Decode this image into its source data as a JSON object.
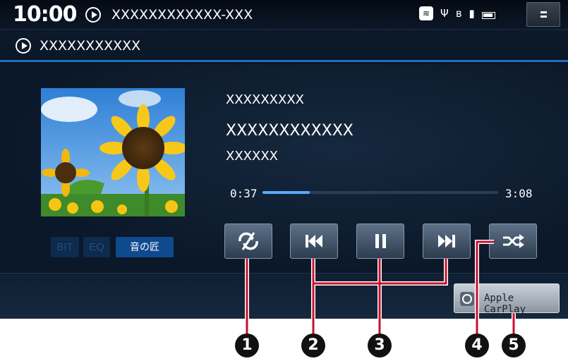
{
  "status_bar": {
    "clock": "10:00",
    "now_playing": "XXXXXXXXXXXX-XXX",
    "icons": [
      "wifi-icon",
      "usb-icon",
      "bluetooth-icon",
      "signal-icon",
      "battery-icon"
    ],
    "menu_icon": "menu-icon"
  },
  "source_bar": {
    "title": "XXXXXXXXXXX"
  },
  "track": {
    "line1": "XXXXXXXXX",
    "line2": "XXXXXXXXXXXX",
    "line3": "XXXXXX",
    "elapsed": "0:37",
    "total": "3:08",
    "progress_fraction": 0.2
  },
  "audio_tags": {
    "bit": "BIT",
    "eq": "EQ",
    "oto": "音の匠"
  },
  "controls": {
    "repeat_icon": "repeat-off-icon",
    "prev_icon": "skip-previous-icon",
    "pause_icon": "pause-icon",
    "next_icon": "skip-next-icon",
    "shuffle_icon": "shuffle-icon"
  },
  "carplay": {
    "label": "Apple CarPlay"
  },
  "callouts": [
    "1",
    "2",
    "3",
    "4",
    "5"
  ],
  "colors": {
    "accent": "#1e6fc0",
    "progress": "#5aa9ff",
    "callout_line": "#c8102e"
  }
}
